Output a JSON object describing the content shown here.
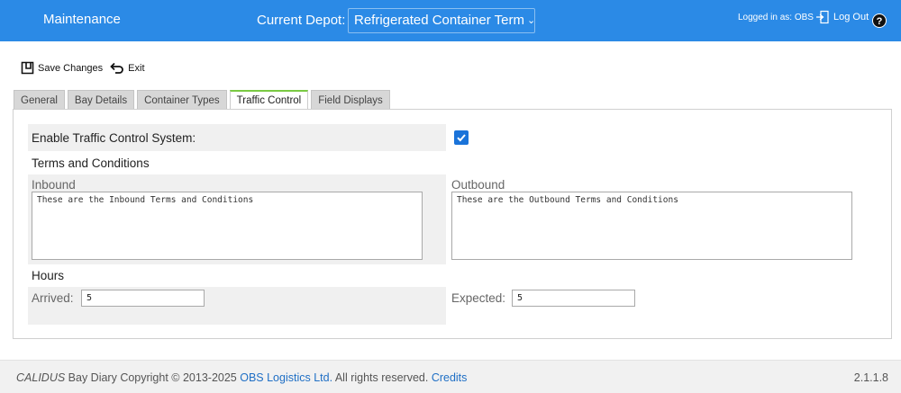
{
  "header": {
    "title": "Maintenance",
    "depot_label": "Current Depot:",
    "depot_value": "Refrigerated Container Term",
    "logged_in": "Logged in as: OBS",
    "logout": "Log Out",
    "help": "?"
  },
  "toolbar": {
    "save_label": "Save Changes",
    "exit_label": "Exit"
  },
  "tabs": [
    {
      "label": "General"
    },
    {
      "label": "Bay Details"
    },
    {
      "label": "Container Types"
    },
    {
      "label": "Traffic Control"
    },
    {
      "label": "Field Displays"
    }
  ],
  "form": {
    "enable_label": "Enable Traffic Control System:",
    "enable_checked": true,
    "terms_heading": "Terms and Conditions",
    "inbound_label": "Inbound",
    "inbound_value": "These are the Inbound Terms and Conditions",
    "outbound_label": "Outbound",
    "outbound_value": "These are the Outbound Terms and Conditions",
    "hours_heading": "Hours",
    "arrived_label": "Arrived:",
    "arrived_value": "5",
    "expected_label": "Expected:",
    "expected_value": "5"
  },
  "footer": {
    "brand": "CALIDUS",
    "copy_text": " Bay Diary Copyright © 2013-2025 ",
    "company": "OBS Logistics Ltd.",
    "rights": " All rights reserved. ",
    "credits": "Credits",
    "version": "2.1.1.8"
  },
  "colors": {
    "header_bg": "#2b8ae6",
    "active_tab_accent": "#7ac943",
    "checkbox": "#1a73d9",
    "link": "#1f6fc5"
  }
}
